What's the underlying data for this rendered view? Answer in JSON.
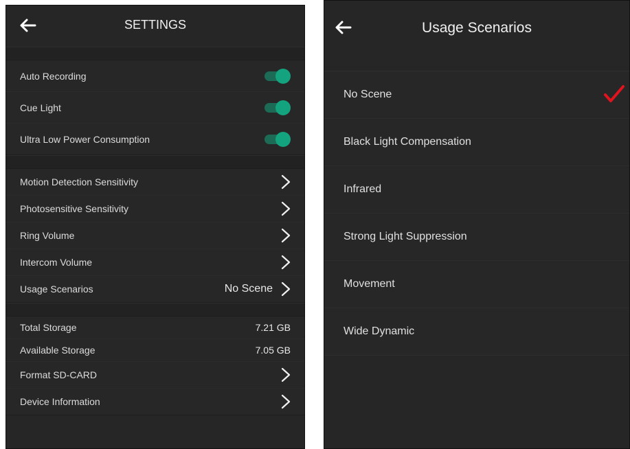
{
  "settings": {
    "title": "SETTINGS",
    "toggles": [
      {
        "label": "Auto Recording",
        "on": true
      },
      {
        "label": "Cue Light",
        "on": true
      },
      {
        "label": "Ultra Low Power Consumption",
        "on": true
      }
    ],
    "menu": [
      {
        "label": "Motion Detection Sensitivity",
        "value": ""
      },
      {
        "label": "Photosensitive Sensitivity",
        "value": ""
      },
      {
        "label": "Ring Volume",
        "value": ""
      },
      {
        "label": "Intercom Volume",
        "value": ""
      },
      {
        "label": "Usage Scenarios",
        "value": "No Scene"
      }
    ],
    "storage": {
      "total_label": "Total Storage",
      "total_value": "7.21 GB",
      "available_label": "Available Storage",
      "available_value": "7.05 GB",
      "format_label": "Format SD-CARD",
      "device_info_label": "Device Information"
    }
  },
  "scenarios": {
    "title": "Usage Scenarios",
    "options": [
      "No Scene",
      "Black Light Compensation",
      "Infrared",
      "Strong Light Suppression",
      "Movement",
      "Wide Dynamic"
    ],
    "selected": "No Scene"
  },
  "colors": {
    "toggle_on": "#14a37f",
    "check": "#e0141e",
    "background": "#262626"
  },
  "icons": {
    "back": "arrow-left-icon",
    "chevron": "chevron-right-icon",
    "check": "checkmark-icon"
  }
}
